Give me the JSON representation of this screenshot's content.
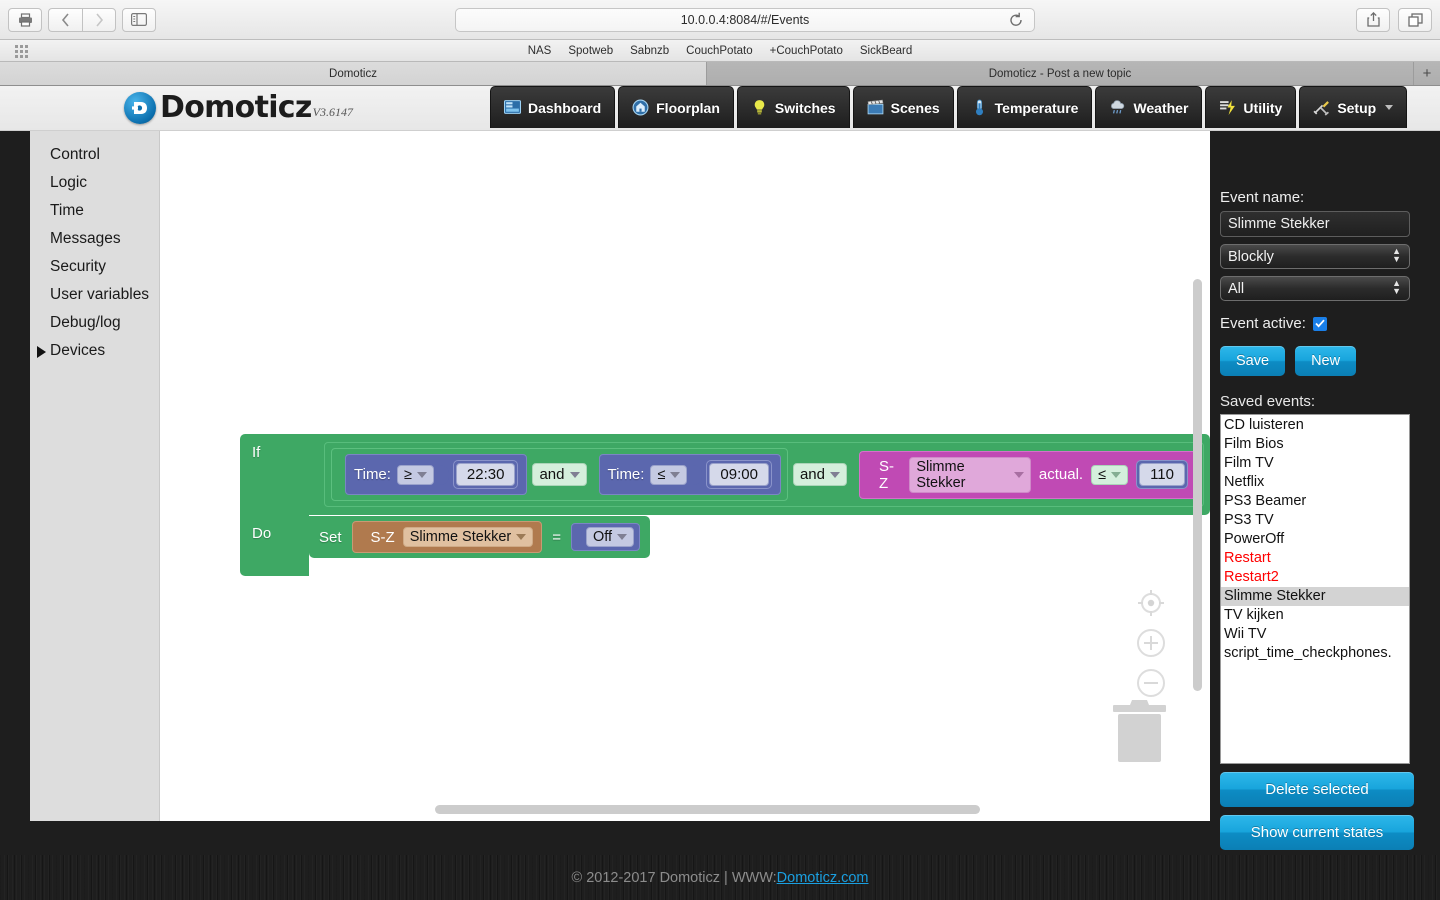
{
  "browser": {
    "url": "10.0.0.4:8084/#/Events",
    "bookmarks": [
      "NAS",
      "Spotweb",
      "Sabnzb",
      "CouchPotato",
      "+CouchPotato",
      "SickBeard"
    ],
    "tabs": [
      {
        "title": "Domoticz",
        "active": true
      },
      {
        "title": "Domoticz - Post a new topic",
        "active": false
      }
    ],
    "new_tab_label": "+"
  },
  "app": {
    "brand_name": "Domoticz",
    "version": "V3.6147",
    "nav": [
      {
        "label": "Dashboard",
        "icon": "dashboard-icon"
      },
      {
        "label": "Floorplan",
        "icon": "floorplan-icon"
      },
      {
        "label": "Switches",
        "icon": "lightbulb-icon"
      },
      {
        "label": "Scenes",
        "icon": "clapperboard-icon"
      },
      {
        "label": "Temperature",
        "icon": "thermometer-icon"
      },
      {
        "label": "Weather",
        "icon": "cloud-rain-icon"
      },
      {
        "label": "Utility",
        "icon": "lightning-icon"
      },
      {
        "label": "Setup",
        "icon": "tools-icon",
        "has_caret": true
      }
    ]
  },
  "toolbox": {
    "items": [
      {
        "label": "Control",
        "expandable": false
      },
      {
        "label": "Logic",
        "expandable": false
      },
      {
        "label": "Time",
        "expandable": false
      },
      {
        "label": "Messages",
        "expandable": false
      },
      {
        "label": "Security",
        "expandable": false
      },
      {
        "label": "User variables",
        "expandable": false
      },
      {
        "label": "Debug/log",
        "expandable": false
      },
      {
        "label": "Devices",
        "expandable": true
      }
    ]
  },
  "blockly": {
    "if_label": "If",
    "do_label": "Do",
    "cond1": {
      "prefix": "Time:",
      "operator": "≥",
      "value": "22:30"
    },
    "and1": "and",
    "cond2": {
      "prefix": "Time:",
      "operator": "≤",
      "value": "09:00"
    },
    "and2": "and",
    "cond3": {
      "group": "S-Z",
      "device": "Slimme Stekker",
      "suffix": "actual.",
      "operator": "≤",
      "value": "110"
    },
    "action": {
      "set_label": "Set",
      "group": "S-Z",
      "device": "Slimme Stekker",
      "equals": "=",
      "state": "Off"
    },
    "controls": {
      "center_icon": "center-target-icon",
      "zoom_in_icon": "zoom-in-icon",
      "zoom_out_icon": "zoom-out-icon",
      "trash_icon": "trash-icon"
    }
  },
  "right_panel": {
    "event_name_label": "Event name:",
    "event_name_value": "Slimme Stekker",
    "type_select_value": "Blockly",
    "filter_select_value": "All",
    "event_active_label": "Event active:",
    "event_active_checked": true,
    "save_label": "Save",
    "new_label": "New",
    "saved_events_label": "Saved events:",
    "saved_events": [
      {
        "name": "CD luisteren",
        "state": "normal"
      },
      {
        "name": "Film Bios",
        "state": "normal"
      },
      {
        "name": "Film TV",
        "state": "normal"
      },
      {
        "name": "Netflix",
        "state": "normal"
      },
      {
        "name": "PS3 Beamer",
        "state": "normal"
      },
      {
        "name": "PS3 TV",
        "state": "normal"
      },
      {
        "name": "PowerOff",
        "state": "normal"
      },
      {
        "name": "Restart",
        "state": "red"
      },
      {
        "name": "Restart2",
        "state": "red"
      },
      {
        "name": "Slimme Stekker",
        "state": "selected"
      },
      {
        "name": "TV kijken",
        "state": "normal"
      },
      {
        "name": "Wii TV",
        "state": "normal"
      },
      {
        "name": "script_time_checkphones.",
        "state": "normal"
      }
    ],
    "delete_selected_label": "Delete selected",
    "show_current_states_label": "Show current states"
  },
  "footer": {
    "text": "© 2012-2017 Domoticz | WWW: ",
    "link": "Domoticz.com"
  },
  "colors": {
    "accent_blue": "#18a5dc",
    "block_green": "#3ea864",
    "block_purple": "#5b67ae",
    "block_magenta": "#c04ab4",
    "block_brown": "#b07a4e",
    "error_red": "#ff0000"
  }
}
